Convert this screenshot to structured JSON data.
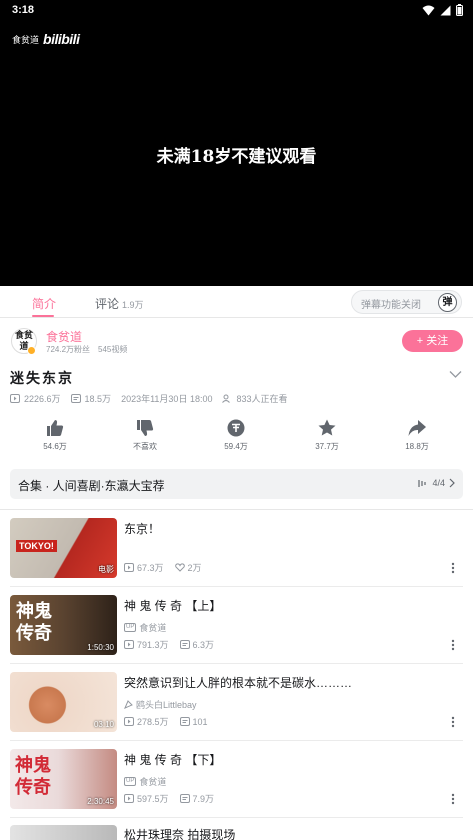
{
  "status_bar": {
    "time": "3:18"
  },
  "player": {
    "uploader_watermark": "食贫道",
    "brand_watermark": "bilibili",
    "caption": "未满18岁不建议观看"
  },
  "tabs": {
    "intro_label": "简介",
    "comments_label": "评论",
    "comments_count": "1.9万",
    "danmaku_label": "弹幕功能关闭",
    "danmaku_icon_text": "弹"
  },
  "uploader": {
    "avatar_text": "食贫道",
    "name": "食贫道",
    "fans": "724.2万粉丝",
    "videos": "545视频",
    "follow_label": "+ 关注"
  },
  "video": {
    "title": "迷失东京",
    "views": "2226.6万",
    "danmaku": "18.5万",
    "date": "2023年11月30日 18:00",
    "watching": "833人正在看"
  },
  "actions": [
    {
      "icon": "like-icon",
      "label": "54.6万"
    },
    {
      "icon": "dislike-icon",
      "label": "不喜欢"
    },
    {
      "icon": "coin-icon",
      "label": "59.4万"
    },
    {
      "icon": "star-icon",
      "label": "37.7万"
    },
    {
      "icon": "share-icon",
      "label": "18.8万"
    }
  ],
  "collection": {
    "title": "合集 · 人间喜剧·东瀛大宝荐",
    "progress": "4/4"
  },
  "videos": [
    {
      "title": "东京！",
      "badge": "电影",
      "uploader": "",
      "views": "67.3万",
      "second_stat": "2万",
      "second_icon": "heart-icon",
      "thumb_text": "TOKYO!",
      "thumb_colors": [
        "#c9c2b7",
        "#b8281f"
      ]
    },
    {
      "title": "神 鬼 传 奇 【上】",
      "badge": "1:50:30",
      "uploader": "食贫道",
      "views": "791.3万",
      "second_stat": "6.3万",
      "second_icon": "danmaku-icon",
      "thumb_text": "神鬼传奇",
      "thumb_colors": [
        "#8a6a4a",
        "#3a2a1e"
      ]
    },
    {
      "title": "突然意识到让人胖的根本就不是碳水………",
      "badge": "03:10",
      "uploader": "鸥头白Littlebay",
      "views": "278.5万",
      "second_stat": "101",
      "second_icon": "danmaku-icon",
      "thumb_text": "",
      "thumb_colors": [
        "#f0ddd0",
        "#d98b62"
      ]
    },
    {
      "title": "神 鬼 传 奇 【下】",
      "badge": "2:30:45",
      "uploader": "食贫道",
      "views": "597.5万",
      "second_stat": "7.9万",
      "second_icon": "danmaku-icon",
      "thumb_text": "神鬼传奇",
      "thumb_colors": [
        "#f2e6e6",
        "#c8303a"
      ]
    },
    {
      "title": "松井珠理奈 拍摄现场",
      "badge": "",
      "uploader": "",
      "views": "",
      "second_stat": "",
      "second_icon": "",
      "thumb_text": "",
      "thumb_colors": [
        "#dcdcdc",
        "#9a9a9a"
      ]
    }
  ],
  "colors": {
    "accent": "#fb7299",
    "muted": "#9499a0"
  }
}
